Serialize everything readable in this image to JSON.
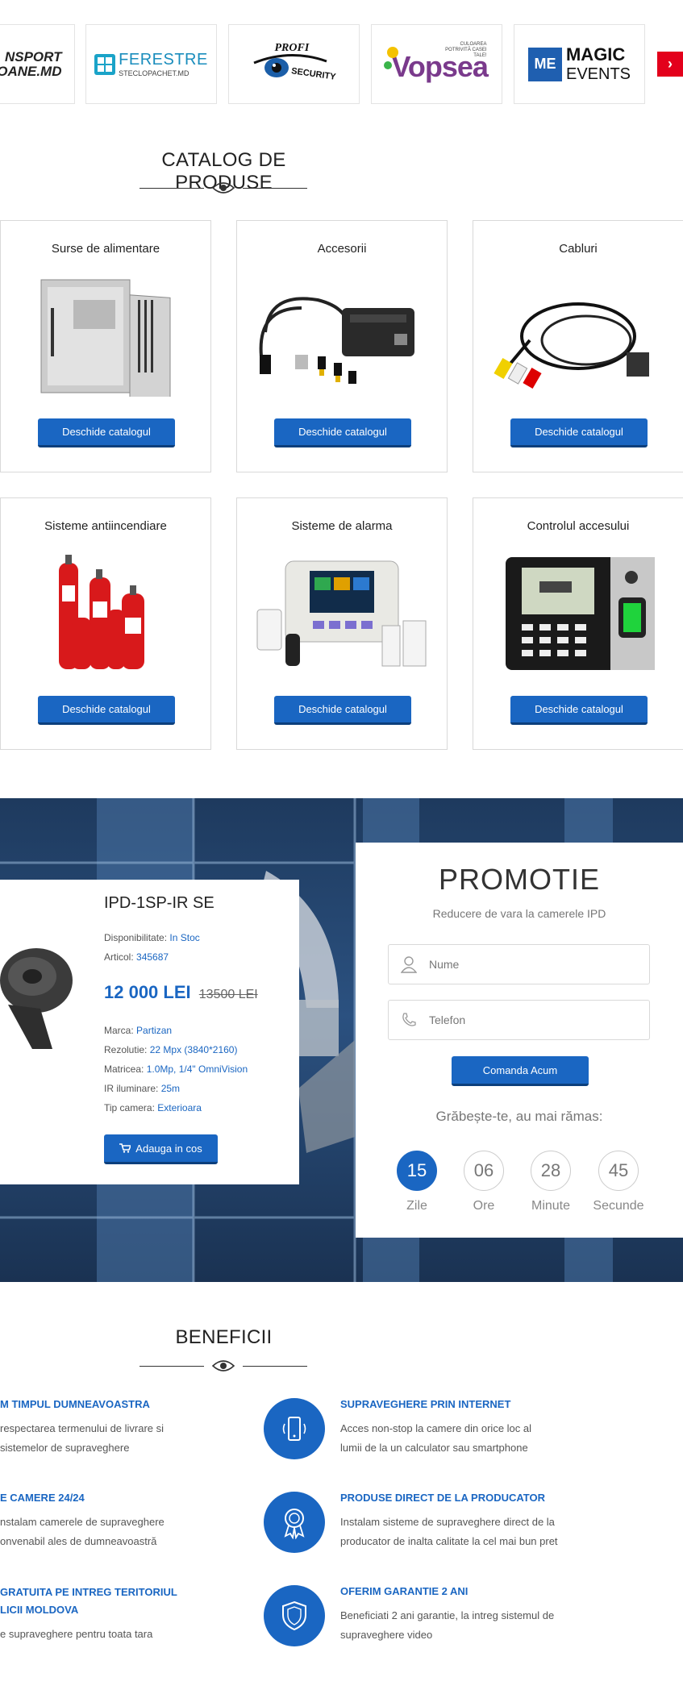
{
  "partners": [
    {
      "line1": "NSPORT",
      "line2": "OANE.MD"
    },
    {
      "line1": "FERESTRE",
      "line2": "STECLOPACHET.MD"
    },
    {
      "line1": "PROFI",
      "line2": "SECURITY"
    },
    {
      "line1": "Vopsea",
      "line2": "CULOAREA POTRIVITĂ CASEI TALE!"
    },
    {
      "line1": "MAGIC",
      "line2": "EVENTS",
      "mark": "ME"
    }
  ],
  "catalog": {
    "title": "CATALOG DE PRODUSE",
    "button_label": "Deschide catalogul",
    "items": [
      {
        "name": "Surse de alimentare"
      },
      {
        "name": "Accesorii"
      },
      {
        "name": "Cabluri"
      },
      {
        "name": "Sisteme antiincendiare"
      },
      {
        "name": "Sisteme de alarma"
      },
      {
        "name": "Controlul accesului"
      }
    ]
  },
  "product": {
    "title": "IPD-1SP-IR SE",
    "availability_label": "Disponibilitate:",
    "availability_value": "In Stoc",
    "article_label": "Articol:",
    "article_value": "345687",
    "price": "12 000 LEI",
    "old_price": "13500 LEI",
    "specs": [
      {
        "label": "Marca:",
        "value": "Partizan"
      },
      {
        "label": "Rezolutie:",
        "value": "22 Mpx (3840*2160)"
      },
      {
        "label": "Matricea:",
        "value": "1.0Mp, 1/4\" OmniVision"
      },
      {
        "label": "IR iluminare:",
        "value": "25m"
      },
      {
        "label": "Tip camera:",
        "value": "Exterioara"
      }
    ],
    "cart_label": "Adauga in cos"
  },
  "promo": {
    "title": "PROMOTIE",
    "subtitle": "Reducere de vara la camerele IPD",
    "name_placeholder": "Nume",
    "phone_placeholder": "Telefon",
    "order_label": "Comanda Acum",
    "hurry": "Grăbește-te, au mai rămas:",
    "countdown": [
      {
        "value": "15",
        "label": "Zile"
      },
      {
        "value": "06",
        "label": "Ore"
      },
      {
        "value": "28",
        "label": "Minute"
      },
      {
        "value": "45",
        "label": "Secunde"
      }
    ]
  },
  "benefits": {
    "title": "BENEFICII",
    "left": [
      {
        "title": "M TIMPUL DUMNEAVOASTRA",
        "text1": "respectarea termenului de livrare si",
        "text2": "sistemelor de supraveghere"
      },
      {
        "title": "E CAMERE 24/24",
        "text1": "nstalam camerele de supraveghere",
        "text2": "onvenabil ales de dumneavoastră"
      },
      {
        "title": "GRATUITA PE INTREG TERITORIUL",
        "title2": "LICII MOLDOVA",
        "text1": "e supraveghere pentru toata tara"
      }
    ],
    "right": [
      {
        "title": "SUPRAVEGHERE PRIN INTERNET",
        "text1": "Acces non-stop la camere din orice loc al",
        "text2": "lumii de la un calculator sau smartphone",
        "icon": "smartphone-icon"
      },
      {
        "title": "PRODUSE DIRECT DE LA PRODUCATOR",
        "text1": "Instalam sisteme de supraveghere direct de la",
        "text2": "producator de inalta calitate la cel mai bun pret",
        "icon": "award-badge-icon"
      },
      {
        "title": "OFERIM GARANTIE 2 ANI",
        "text1": "Beneficiati 2 ani garantie, la intreg sistemul de",
        "text2": "supraveghere video",
        "icon": "shield-icon"
      }
    ]
  },
  "colors": {
    "accent": "#1a66c2",
    "accent_dark": "#0c3f7c",
    "arrow": "#e3001b"
  }
}
